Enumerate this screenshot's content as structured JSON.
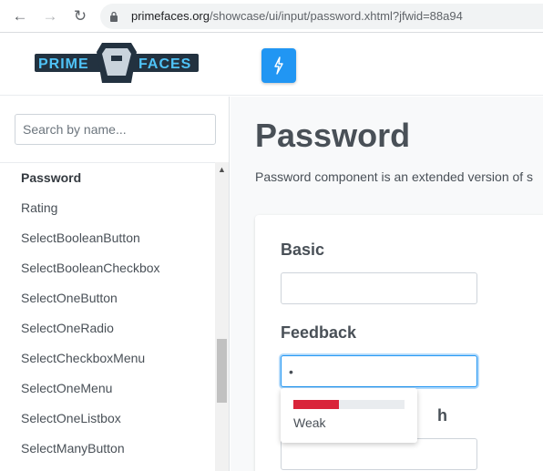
{
  "browser": {
    "url_host": "primefaces.org",
    "url_path": "/showcase/ui/input/password.xhtml?jfwid=88a94"
  },
  "header": {
    "logo_left": "PRIME",
    "logo_right": "FACES",
    "menu_icon": "bolt-icon"
  },
  "sidebar": {
    "search_placeholder": "Search by name...",
    "items": [
      {
        "label": "Password",
        "active": true
      },
      {
        "label": "Rating"
      },
      {
        "label": "SelectBooleanButton"
      },
      {
        "label": "SelectBooleanCheckbox"
      },
      {
        "label": "SelectOneButton"
      },
      {
        "label": "SelectOneRadio"
      },
      {
        "label": "SelectCheckboxMenu"
      },
      {
        "label": "SelectOneMenu"
      },
      {
        "label": "SelectOneListbox"
      },
      {
        "label": "SelectManyButton"
      }
    ]
  },
  "main": {
    "title": "Password",
    "description": "Password component is an extended version of s",
    "fields": {
      "basic_label": "Basic",
      "basic_value": "",
      "feedback_label": "Feedback",
      "feedback_value": "•",
      "third_label_fragment": "h",
      "third_value": ""
    },
    "strength": {
      "label": "Weak",
      "level": 0.41,
      "color": "#d9243a"
    }
  },
  "colors": {
    "accent": "#2196f3",
    "weak": "#d9243a"
  }
}
